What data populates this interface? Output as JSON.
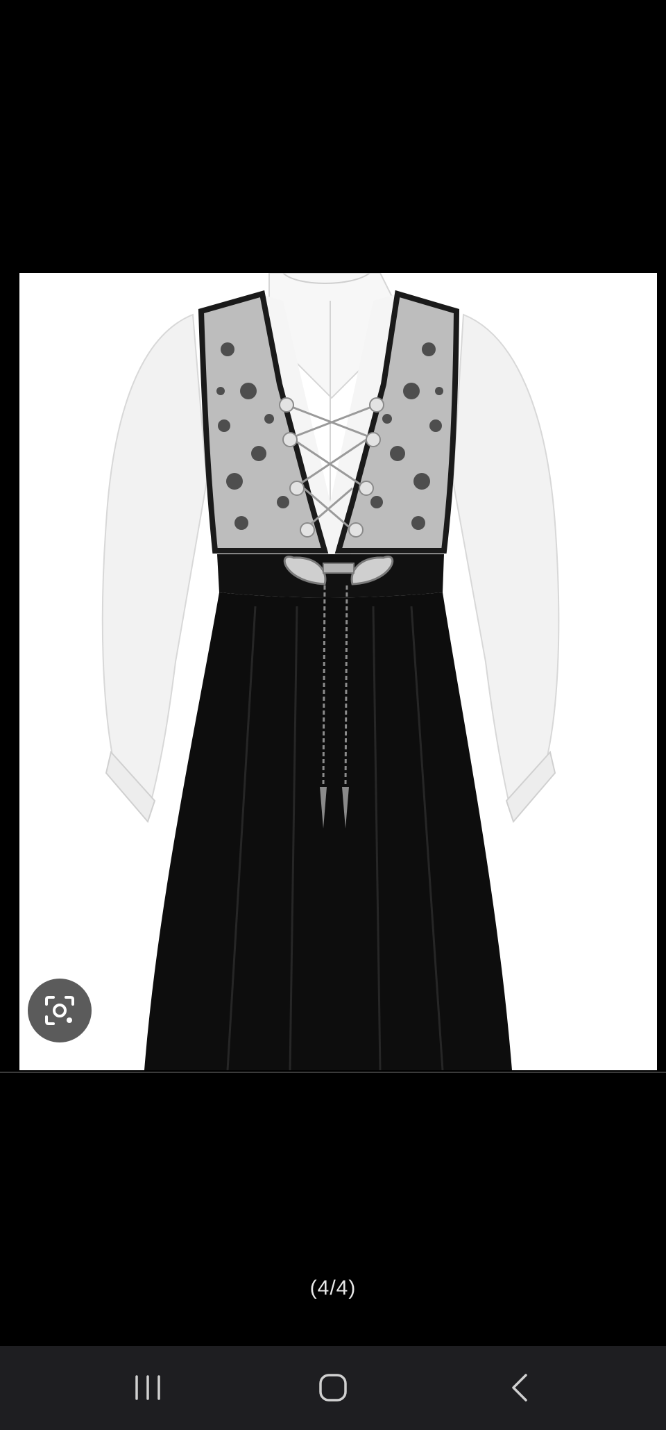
{
  "viewer": {
    "page_counter": "(4/4)"
  },
  "image": {
    "subject": "folk-costume-bunad-photo"
  },
  "lens": {
    "icon": "lens-search-icon"
  },
  "navigation_bar": {
    "recent_apps_icon": "recent-apps-icon",
    "home_icon": "home-icon",
    "back_icon": "back-icon"
  },
  "colors": {
    "background": "#000000",
    "image_background": "#ffffff",
    "lens_button": "#5b5b5b",
    "navbar": "#1e1e21",
    "counter_text": "#e8e8e8"
  }
}
